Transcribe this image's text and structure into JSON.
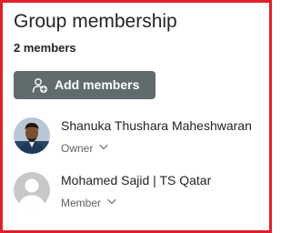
{
  "panel": {
    "title": "Group membership",
    "member_count": "2 members"
  },
  "actions": {
    "add_members_label": "Add members",
    "add_members_icon": "add-people-icon"
  },
  "members": [
    {
      "name": "Shanuka Thushara Maheshwaran",
      "role": "Owner",
      "avatar": "photo-avatar"
    },
    {
      "name": "Mohamed Sajid | TS Qatar",
      "role": "Member",
      "avatar": "placeholder-avatar"
    }
  ],
  "colors": {
    "border": "#e0202b",
    "button_bg": "#5f6b6d",
    "text": "#242424",
    "secondary_text": "#616161"
  }
}
